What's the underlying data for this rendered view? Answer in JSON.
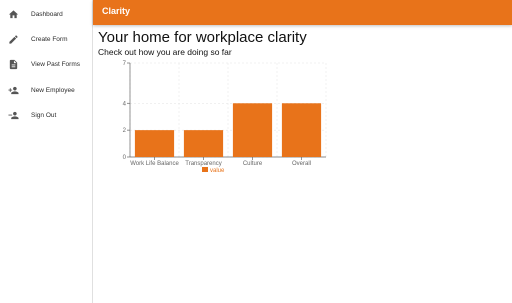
{
  "sidebar": {
    "items": [
      {
        "label": "Dashboard",
        "icon": "home-icon"
      },
      {
        "label": "Create Form",
        "icon": "pencil-icon"
      },
      {
        "label": "View Past Forms",
        "icon": "document-icon"
      },
      {
        "label": "New Employee",
        "icon": "person-add-icon"
      },
      {
        "label": "Sign Out",
        "icon": "person-remove-icon"
      }
    ]
  },
  "appbar": {
    "title": "Clarity",
    "color": "#e8731a"
  },
  "main": {
    "title": "Your home for workplace clarity",
    "subtitle": "Check out how you are doing so far"
  },
  "chart_data": {
    "type": "bar",
    "categories": [
      "Work Life Balance",
      "Transparency",
      "Culture",
      "Overall"
    ],
    "series": [
      {
        "name": "value",
        "values": [
          2,
          2,
          4,
          4
        ],
        "color": "#e8731a"
      }
    ],
    "ylim": [
      0,
      7
    ],
    "yticks": [
      0,
      2,
      4,
      7
    ],
    "grid": true,
    "legend": "bottom"
  }
}
